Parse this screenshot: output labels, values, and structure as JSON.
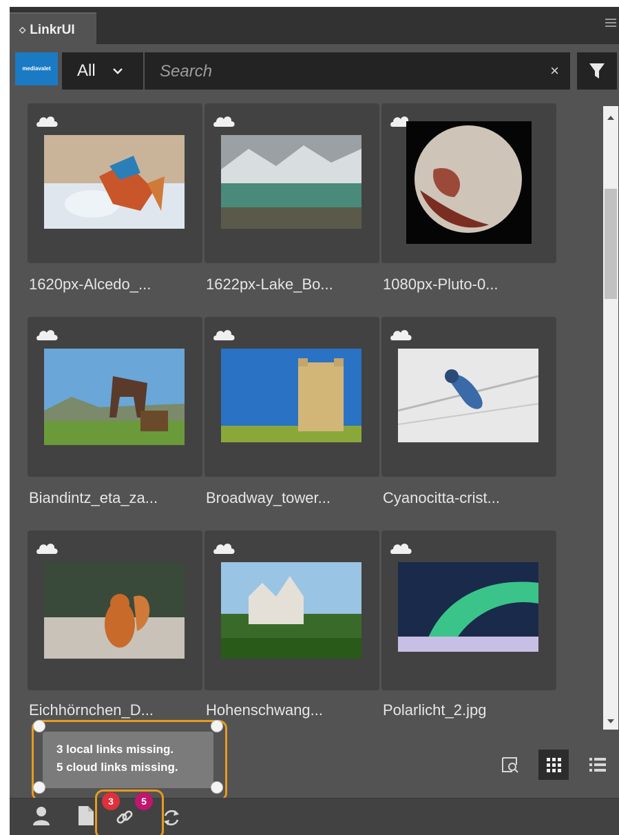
{
  "panel": {
    "tab_label": "LinkrUI",
    "logo_text": "mediavalet"
  },
  "search": {
    "filter_value": "All",
    "placeholder": "Search",
    "clear_label": "×"
  },
  "assets": [
    {
      "name": "1620px-Alcedo_...",
      "icon": "cloud-icon"
    },
    {
      "name": "1622px-Lake_Bo...",
      "icon": "cloud-icon"
    },
    {
      "name": "1080px-Pluto-0...",
      "icon": "cloud-icon"
    },
    {
      "name": "Biandintz_eta_za...",
      "icon": "cloud-icon"
    },
    {
      "name": "Broadway_tower...",
      "icon": "cloud-icon"
    },
    {
      "name": "Cyanocitta-crist...",
      "icon": "cloud-icon"
    },
    {
      "name": "Eichhörnchen_D...",
      "icon": "cloud-icon"
    },
    {
      "name": "Hohenschwang...",
      "icon": "cloud-icon"
    },
    {
      "name": "Polarlicht_2.jpg",
      "icon": "cloud-icon"
    }
  ],
  "status": {
    "local_missing": "3 local links missing.",
    "cloud_missing": "5 cloud links missing.",
    "local_badge": "3",
    "cloud_badge": "5"
  },
  "colors": {
    "panel_bg": "#535353",
    "highlight": "#e89a1e",
    "badge_local": "#e0303a",
    "badge_cloud": "#c0166e",
    "logo_bg": "#1b7ac4"
  }
}
